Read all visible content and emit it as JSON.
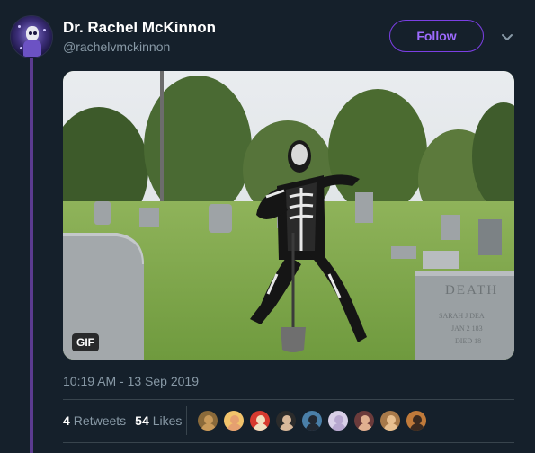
{
  "author": {
    "name": "Dr. Rachel McKinnon",
    "handle": "@rachelvmckinnon"
  },
  "actions": {
    "follow_label": "Follow",
    "more_icon": "chevron-down-icon"
  },
  "media": {
    "badge": "GIF",
    "headstone_text": "DEATH",
    "headstone_subtext": [
      "SARAH J DEA",
      "JAN 2 183",
      "DIED 18"
    ]
  },
  "tweet": {
    "timestamp": "10:19 AM - 13 Sep 2019"
  },
  "stats": {
    "retweets_count": "4",
    "retweets_label": "Retweets",
    "likes_count": "54",
    "likes_label": "Likes"
  },
  "colors": {
    "background": "#15202b",
    "accent": "#7b3fe4",
    "muted": "#8899a6",
    "thread_line": "#5b3b8f"
  },
  "likers": [
    {
      "name": "liker-avatar-1",
      "bg": "#8a6a3a",
      "face": "#c89a5a"
    },
    {
      "name": "liker-avatar-2",
      "bg": "#f2c36b",
      "face": "#e6a070"
    },
    {
      "name": "liker-avatar-3",
      "bg": "#d63a2f",
      "face": "#f0e0c0"
    },
    {
      "name": "liker-avatar-4",
      "bg": "#2b2b2b",
      "face": "#d8b89a"
    },
    {
      "name": "liker-avatar-5",
      "bg": "#4a7fa8",
      "face": "#222831"
    },
    {
      "name": "liker-avatar-6",
      "bg": "#d9d0e8",
      "face": "#b8a8d0"
    },
    {
      "name": "liker-avatar-7",
      "bg": "#6b3b3b",
      "face": "#e0b090"
    },
    {
      "name": "liker-avatar-8",
      "bg": "#a87a4a",
      "face": "#e8c090"
    },
    {
      "name": "liker-avatar-9",
      "bg": "#c07a3a",
      "face": "#3a2a20"
    }
  ]
}
